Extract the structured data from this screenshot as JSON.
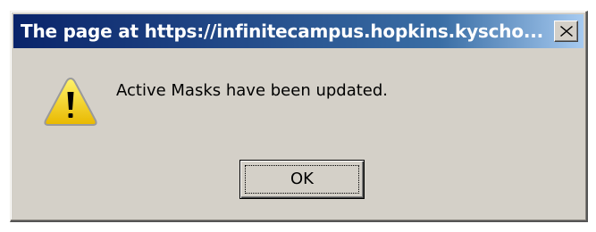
{
  "dialog": {
    "title": "The page at https://infinitecampus.hopkins.kyscho...",
    "message": "Active Masks have been updated.",
    "ok_label": "OK",
    "icon": "warning-icon"
  },
  "colors": {
    "dialog_face": "#d4d0c8",
    "titlebar_start": "#0a246a",
    "titlebar_end": "#a6caf0",
    "warning_fill": "#f7d417"
  }
}
